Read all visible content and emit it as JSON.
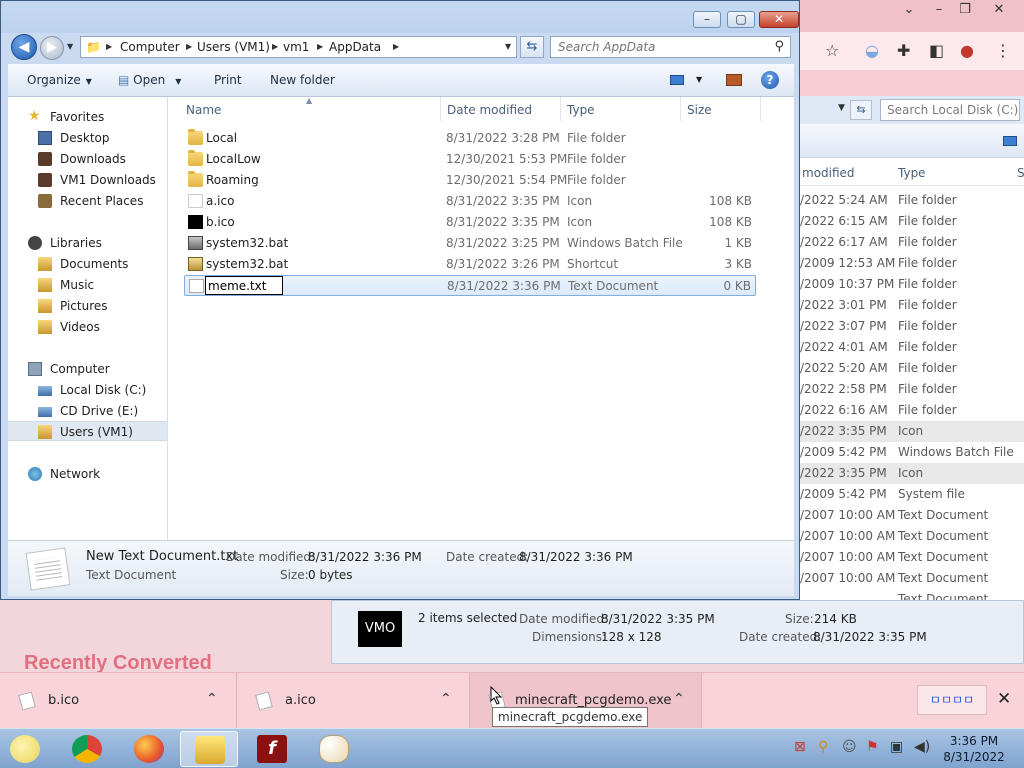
{
  "explorer": {
    "address_crumbs": [
      "Computer",
      "Users (VM1)",
      "vm1",
      "AppData"
    ],
    "search_placeholder": "Search AppData",
    "toolbar": {
      "organize": "Organize",
      "open": "Open",
      "print": "Print",
      "new_folder": "New folder"
    },
    "nav": {
      "favorites": "Favorites",
      "desktop": "Desktop",
      "downloads": "Downloads",
      "vm1_downloads": "VM1 Downloads",
      "recent_places": "Recent Places",
      "libraries": "Libraries",
      "documents": "Documents",
      "music": "Music",
      "pictures": "Pictures",
      "videos": "Videos",
      "computer": "Computer",
      "local_disk": "Local Disk (C:)",
      "cd_drive": "CD Drive (E:)",
      "users_vm1": "Users (VM1)",
      "network": "Network"
    },
    "columns": {
      "name": "Name",
      "date": "Date modified",
      "type": "Type",
      "size": "Size"
    },
    "files": [
      {
        "name": "Local",
        "date": "8/31/2022 3:28 PM",
        "type": "File folder",
        "size": ""
      },
      {
        "name": "LocalLow",
        "date": "12/30/2021 5:53 PM",
        "type": "File folder",
        "size": ""
      },
      {
        "name": "Roaming",
        "date": "12/30/2021 5:54 PM",
        "type": "File folder",
        "size": ""
      },
      {
        "name": "a.ico",
        "date": "8/31/2022 3:35 PM",
        "type": "Icon",
        "size": "108 KB"
      },
      {
        "name": "b.ico",
        "date": "8/31/2022 3:35 PM",
        "type": "Icon",
        "size": "108 KB"
      },
      {
        "name": "system32.bat",
        "date": "8/31/2022 3:25 PM",
        "type": "Windows Batch File",
        "size": "1 KB"
      },
      {
        "name": "system32.bat",
        "date": "8/31/2022 3:26 PM",
        "type": "Shortcut",
        "size": "3 KB"
      },
      {
        "name": "",
        "date": "8/31/2022 3:36 PM",
        "type": "Text Document",
        "size": "0 KB"
      }
    ],
    "rename_value": "meme.txt",
    "details": {
      "name": "New Text Document.txt",
      "type": "Text Document",
      "date_modified_label": "Date modified:",
      "date_modified": "8/31/2022 3:36 PM",
      "date_created_label": "Date created:",
      "date_created": "8/31/2022 3:36 PM",
      "size_label": "Size:",
      "size": "0 bytes"
    }
  },
  "bg_explorer": {
    "search_placeholder": "Search Local Disk (C:)",
    "col_modified": "modified",
    "col_type": "Type",
    "col_s": "S",
    "rows": [
      {
        "date": "/2022 5:24 AM",
        "type": "File folder"
      },
      {
        "date": "/2022 6:15 AM",
        "type": "File folder"
      },
      {
        "date": "/2022 6:17 AM",
        "type": "File folder"
      },
      {
        "date": "/2009 12:53 AM",
        "type": "File folder"
      },
      {
        "date": "/2009 10:37 PM",
        "type": "File folder"
      },
      {
        "date": "/2022 3:01 PM",
        "type": "File folder"
      },
      {
        "date": "/2022 3:07 PM",
        "type": "File folder"
      },
      {
        "date": "/2022 4:01 AM",
        "type": "File folder"
      },
      {
        "date": "/2022 5:20 AM",
        "type": "File folder"
      },
      {
        "date": "/2022 2:58 PM",
        "type": "File folder"
      },
      {
        "date": "/2022 6:16 AM",
        "type": "File folder"
      },
      {
        "date": "/2022 3:35 PM",
        "type": "Icon"
      },
      {
        "date": "/2009 5:42 PM",
        "type": "Windows Batch File"
      },
      {
        "date": "/2022 3:35 PM",
        "type": "Icon"
      },
      {
        "date": "/2009 5:42 PM",
        "type": "System file"
      },
      {
        "date": "/2007 10:00 AM",
        "type": "Text Document"
      },
      {
        "date": "/2007 10:00 AM",
        "type": "Text Document"
      },
      {
        "date": "/2007 10:00 AM",
        "type": "Text Document"
      },
      {
        "date": "/2007 10:00 AM",
        "type": "Text Document"
      },
      {
        "date": "",
        "type": "Text Document"
      }
    ],
    "details": {
      "thumb_text": "VMO",
      "selected": "2 items selected",
      "date_modified_label": "Date modified:",
      "date_modified": "8/31/2022 3:35 PM",
      "size_label": "Size:",
      "size": "214 KB",
      "dimensions_label": "Dimensions:",
      "dimensions": "128 x 128",
      "date_created_label": "Date created:",
      "date_created": "8/31/2022 3:35 PM"
    }
  },
  "page_heading": "Recently Converted",
  "downloads": [
    {
      "name": "b.ico"
    },
    {
      "name": "a.ico"
    },
    {
      "name": "minecraft_pcgdemo.exe"
    }
  ],
  "downloads_show_all": "ㅁㅁㅁㅁ",
  "tooltip": "minecraft_pcgdemo.exe",
  "taskbar": {
    "time": "3:36 PM",
    "date": "8/31/2022"
  }
}
